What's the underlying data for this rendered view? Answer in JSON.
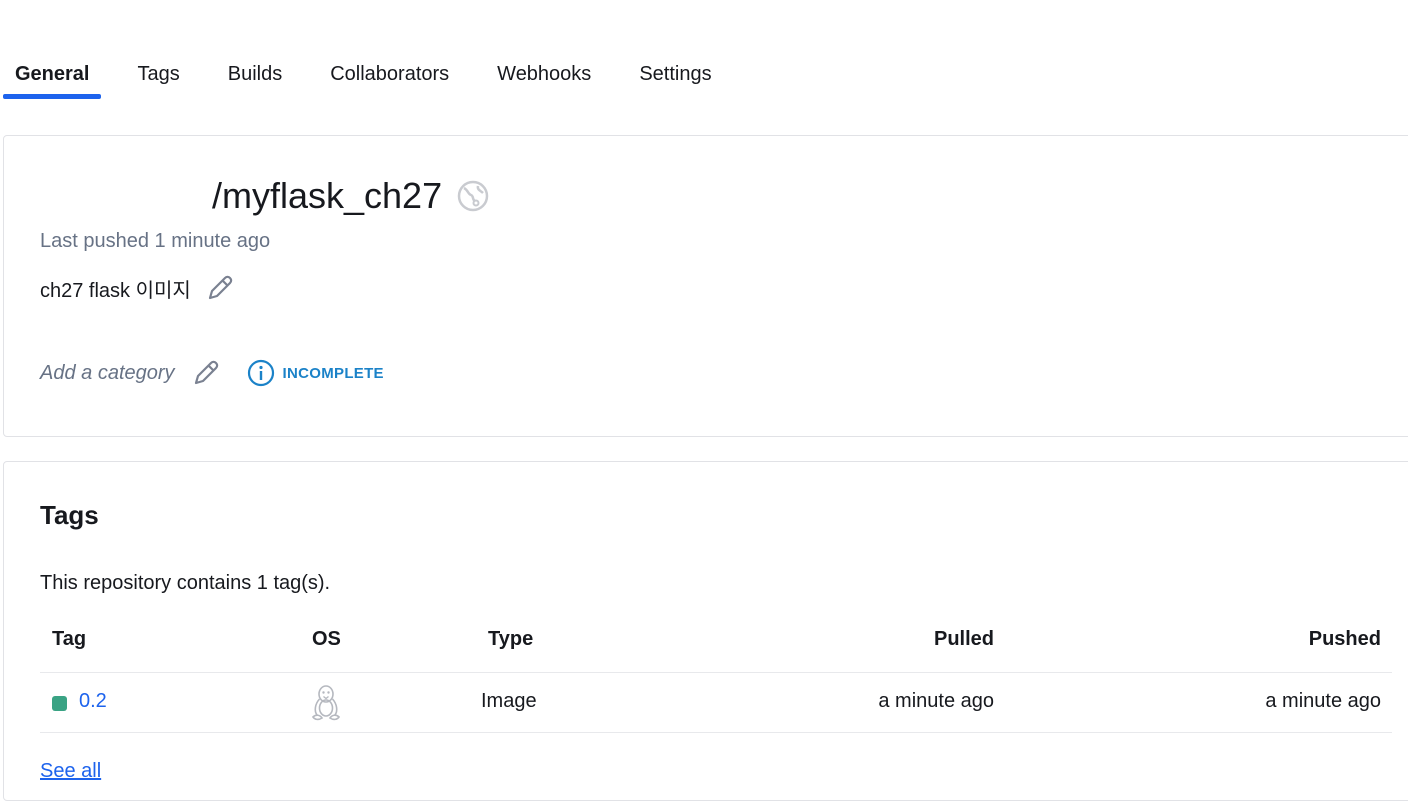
{
  "tabs": [
    {
      "label": "General",
      "active": true
    },
    {
      "label": "Tags"
    },
    {
      "label": "Builds"
    },
    {
      "label": "Collaborators"
    },
    {
      "label": "Webhooks"
    },
    {
      "label": "Settings"
    }
  ],
  "repo": {
    "title": "/myflask_ch27",
    "visibility_icon": "globe-icon",
    "last_pushed": "Last pushed 1 minute ago",
    "description": "ch27 flask 이미지",
    "category_placeholder": "Add a category",
    "status_label": "INCOMPLETE"
  },
  "tags_section": {
    "title": "Tags",
    "summary": "This repository contains 1 tag(s).",
    "columns": {
      "tag": "Tag",
      "os": "OS",
      "type": "Type",
      "pulled": "Pulled",
      "pushed": "Pushed"
    },
    "rows": [
      {
        "tag": "0.2",
        "os_icon": "linux-icon",
        "type": "Image",
        "pulled": "a minute ago",
        "pushed": "a minute ago"
      }
    ],
    "see_all": "See all"
  },
  "colors": {
    "accent": "#1d63ed",
    "status_info": "#1b82c8",
    "tag_dot": "#3aa384",
    "muted_text": "#677285"
  }
}
